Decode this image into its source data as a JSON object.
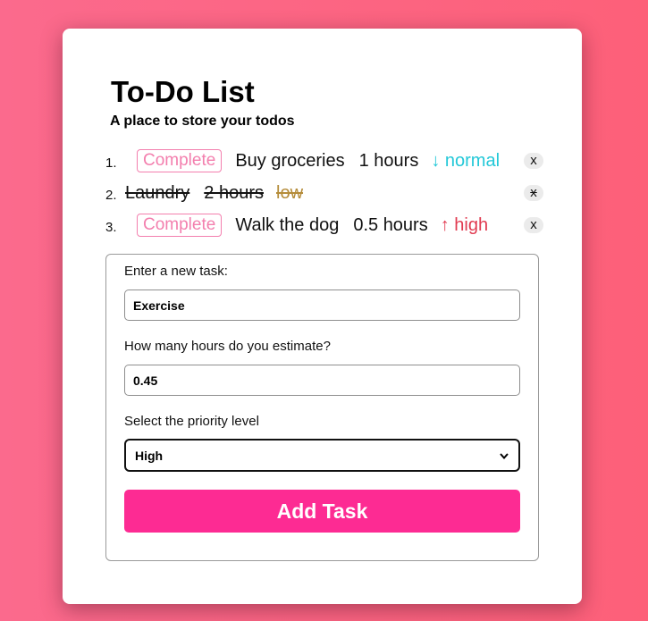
{
  "header": {
    "title": "To-Do List",
    "subtitle": "A place to store your todos"
  },
  "todos": [
    {
      "index": "1.",
      "complete_label": "Complete",
      "name": "Buy groceries",
      "hours": "1 hours",
      "priority_arrow": "↓",
      "priority": "normal",
      "delete_label": "x",
      "done": false
    },
    {
      "index": "2.",
      "name": "Laundry",
      "hours": "2 hours",
      "priority": "low",
      "delete_label": "x",
      "done": true
    },
    {
      "index": "3.",
      "complete_label": "Complete",
      "name": "Walk the dog",
      "hours": "0.5 hours",
      "priority_arrow": "↑",
      "priority": "high",
      "delete_label": "x",
      "done": false
    }
  ],
  "form": {
    "task_label": "Enter a new task:",
    "task_value": "Exercise",
    "hours_label": "How many hours do you estimate?",
    "hours_value": "0.45",
    "priority_label": "Select the priority level",
    "priority_value": "High",
    "submit_label": "Add Task"
  },
  "colors": {
    "accent": "#fd2b93",
    "normal": "#23c8d8",
    "high": "#e13a50",
    "low": "#b58c3a",
    "complete_outline": "#f37fae"
  },
  "icons": {
    "select_arrow": "chevron-down-icon"
  }
}
